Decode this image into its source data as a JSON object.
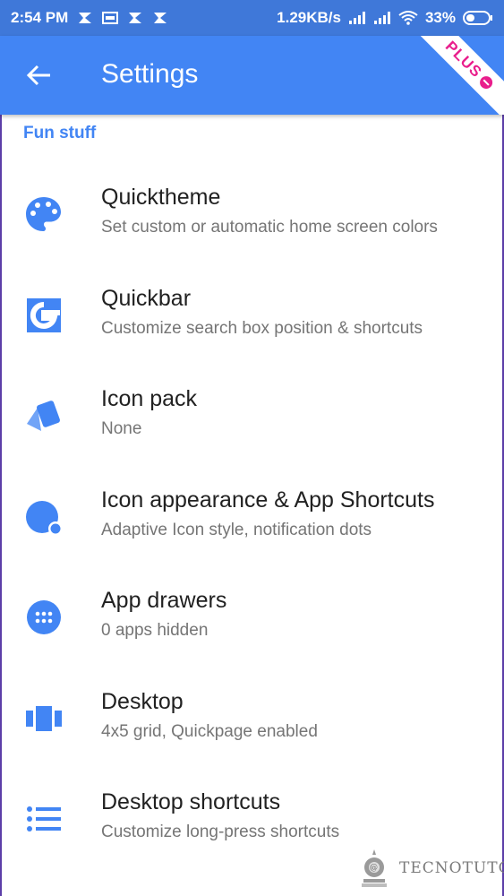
{
  "status_bar": {
    "time": "2:54 PM",
    "network_speed": "1.29KB/s",
    "battery": "33%",
    "bg_color": "#3f78d9"
  },
  "app_bar": {
    "title": "Settings",
    "badge": "PLUS",
    "color": "#4285f4"
  },
  "section": {
    "label": "Fun stuff",
    "color": "#4285f4"
  },
  "items": [
    {
      "title": "Quicktheme",
      "subtitle": "Set custom or automatic home screen colors",
      "icon": "palette-icon"
    },
    {
      "title": "Quickbar",
      "subtitle": "Customize search box position & shortcuts",
      "icon": "google-g-icon"
    },
    {
      "title": "Icon pack",
      "subtitle": "None",
      "icon": "icon-pack-icon"
    },
    {
      "title": "Icon appearance & App Shortcuts",
      "subtitle": "Adaptive Icon style, notification dots",
      "icon": "adaptive-icon"
    },
    {
      "title": "App drawers",
      "subtitle": "0 apps hidden",
      "icon": "app-drawer-icon"
    },
    {
      "title": "Desktop",
      "subtitle": "4x5 grid, Quickpage enabled",
      "icon": "desktop-icon"
    },
    {
      "title": "Desktop shortcuts",
      "subtitle": "Customize long-press shortcuts",
      "icon": "list-icon"
    }
  ],
  "watermark": {
    "text": "TECNOTUTO"
  }
}
